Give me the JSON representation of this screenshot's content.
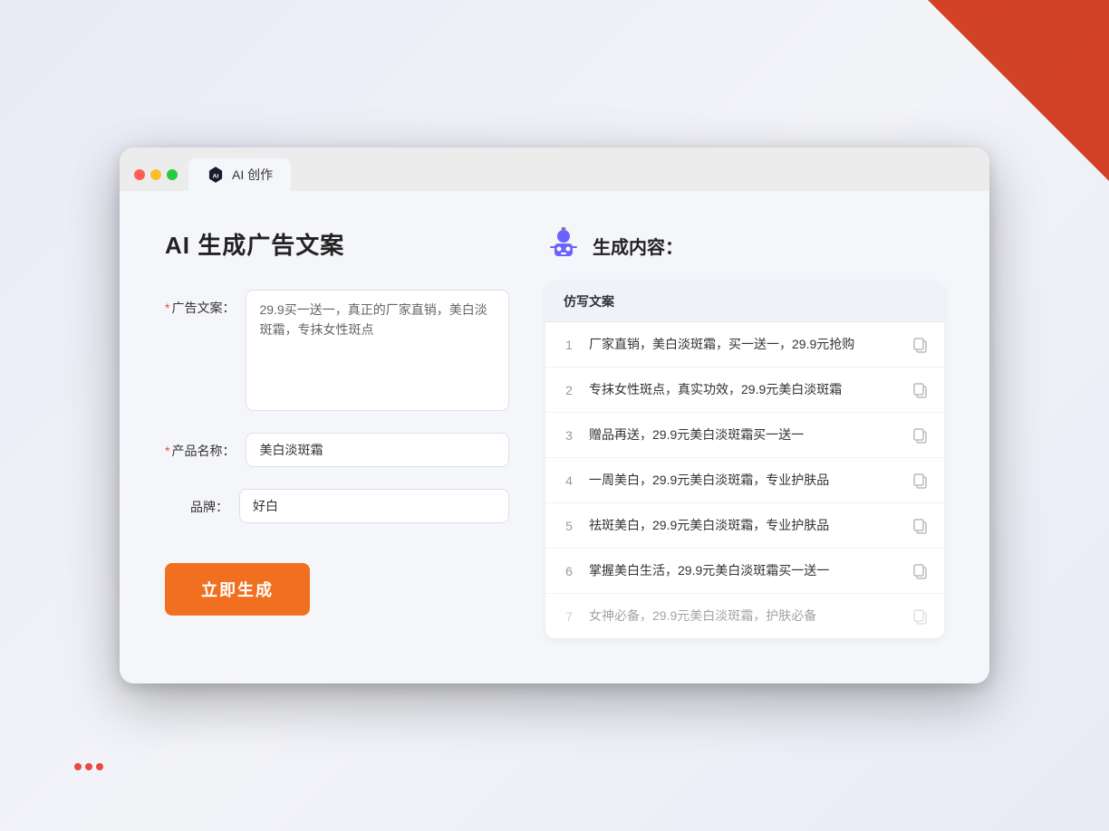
{
  "scene": {
    "bg_color": "#e8eaf6"
  },
  "browser": {
    "tab_label": "AI 创作",
    "traffic_lights": [
      "red",
      "yellow",
      "green"
    ]
  },
  "left_panel": {
    "title": "AI 生成广告文案",
    "fields": [
      {
        "id": "ad_copy",
        "label": "广告文案：",
        "required": true,
        "type": "textarea",
        "value": "29.9买一送一，真正的厂家直销，美白淡斑霜，专抹女性斑点"
      },
      {
        "id": "product_name",
        "label": "产品名称：",
        "required": true,
        "type": "input",
        "value": "美白淡斑霜"
      },
      {
        "id": "brand",
        "label": "品牌：",
        "required": false,
        "type": "input",
        "value": "好白"
      }
    ],
    "generate_button": "立即生成"
  },
  "right_panel": {
    "title": "生成内容：",
    "table_header": "仿写文案",
    "results": [
      {
        "num": 1,
        "text": "厂家直销，美白淡斑霜，买一送一，29.9元抢购",
        "faded": false
      },
      {
        "num": 2,
        "text": "专抹女性斑点，真实功效，29.9元美白淡斑霜",
        "faded": false
      },
      {
        "num": 3,
        "text": "赠品再送，29.9元美白淡斑霜买一送一",
        "faded": false
      },
      {
        "num": 4,
        "text": "一周美白，29.9元美白淡斑霜，专业护肤品",
        "faded": false
      },
      {
        "num": 5,
        "text": "祛斑美白，29.9元美白淡斑霜，专业护肤品",
        "faded": false
      },
      {
        "num": 6,
        "text": "掌握美白生活，29.9元美白淡斑霜买一送一",
        "faded": false
      },
      {
        "num": 7,
        "text": "女神必备，29.9元美白淡斑霜，护肤必备",
        "faded": true
      }
    ]
  }
}
